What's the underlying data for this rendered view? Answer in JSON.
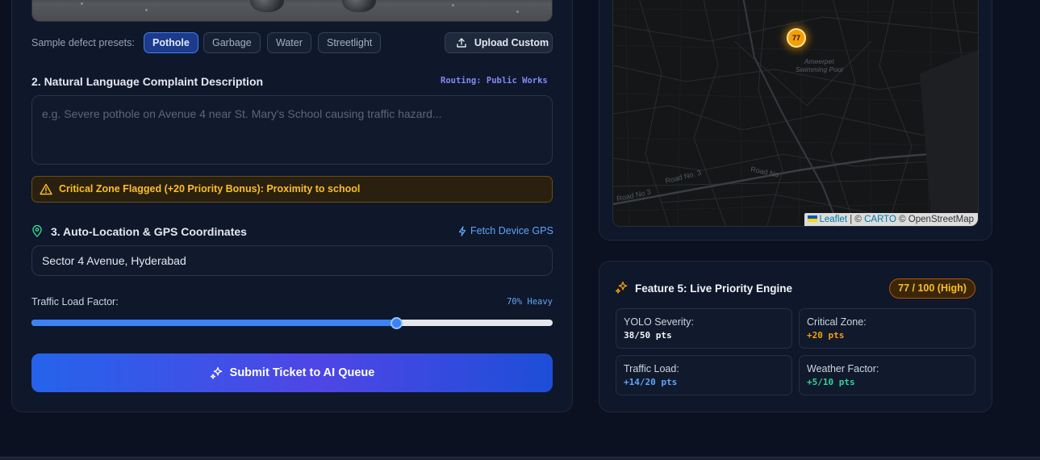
{
  "presets": {
    "label": "Sample defect presets:",
    "items": [
      "Pothole",
      "Garbage",
      "Water",
      "Streetlight"
    ],
    "active": "Pothole",
    "upload_label": "Upload Custom"
  },
  "description": {
    "title": "2. Natural Language Complaint Description",
    "routing": "Routing: Public Works",
    "placeholder": "e.g. Severe pothole on Avenue 4 near St. Mary's School causing traffic hazard...",
    "value": ""
  },
  "warning": {
    "text": "Critical Zone Flagged (+20 Priority Bonus): Proximity to school",
    "color": "#fbbf24"
  },
  "location": {
    "title": "3. Auto-Location & GPS Coordinates",
    "fetch_label": "Fetch Device GPS",
    "value": "Sector 4 Avenue, Hyderabad"
  },
  "traffic": {
    "label": "Traffic Load Factor:",
    "value_label": "70% Heavy",
    "level": 0.7
  },
  "submit": {
    "label": "Submit Ticket to AI Queue"
  },
  "map": {
    "marker_label": "77",
    "place_label_1": "Ameerpet",
    "place_label_2": "Swimming Pool",
    "road_label_1": "Road No 3",
    "road_label_2": "Road No. 3",
    "road_label_3": "Road No",
    "attribution": {
      "leaflet": "Leaflet",
      "separator": "| ©",
      "carto": "CARTO",
      "osm": "© OpenStreetMap"
    }
  },
  "engine": {
    "title": "Feature 5: Live Priority Engine",
    "score": "77 / 100 (High)",
    "metrics": [
      {
        "label": "YOLO Severity:",
        "value": "38/50 pts",
        "color": "#f1f5f9"
      },
      {
        "label": "Critical Zone:",
        "value": "+20 pts",
        "color": "#f59e0b"
      },
      {
        "label": "Traffic Load:",
        "value": "+14/20 pts",
        "color": "#60a5fa"
      },
      {
        "label": "Weather Factor:",
        "value": "+5/10 pts",
        "color": "#34d399"
      }
    ]
  }
}
